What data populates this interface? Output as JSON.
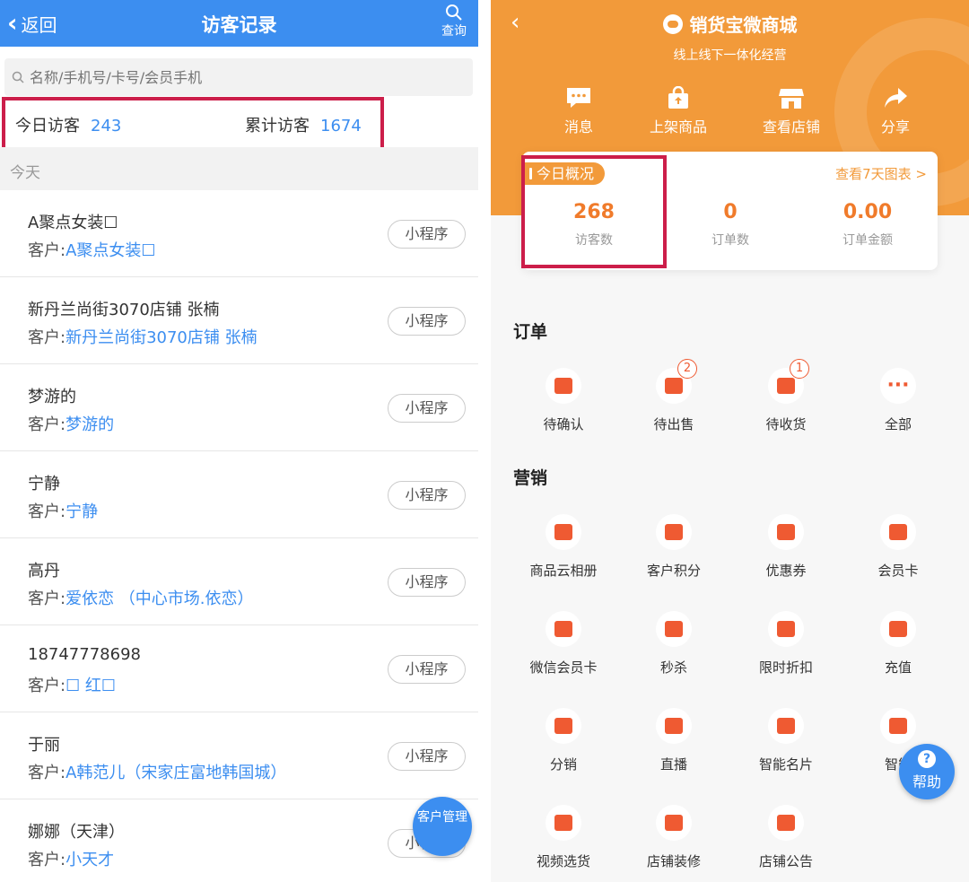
{
  "left": {
    "header": {
      "back_label": "返回",
      "title": "访客记录",
      "query_label": "查询"
    },
    "search": {
      "placeholder": "名称/手机号/卡号/会员手机"
    },
    "stats": {
      "today_label": "今日访客",
      "today_value": "243",
      "total_label": "累计访客",
      "total_value": "1674"
    },
    "section_label": "今天",
    "customer_prefix": "客户:",
    "visitors": [
      {
        "name": "A聚点女装☐",
        "customer": "A聚点女装☐",
        "tag": "小程序"
      },
      {
        "name": "新丹兰尚街3070店铺 张楠",
        "customer": "新丹兰尚街3070店铺 张楠",
        "tag": "小程序"
      },
      {
        "name": "梦游的",
        "customer": "梦游的",
        "tag": "小程序"
      },
      {
        "name": "宁静",
        "customer": "宁静",
        "tag": "小程序"
      },
      {
        "name": "高丹",
        "customer": "爱依恋 （中心市场.依恋）",
        "tag": "小程序"
      },
      {
        "name": "18747778698",
        "customer": "☐ 红☐",
        "tag": "小程序"
      },
      {
        "name": "于丽",
        "customer": "A韩范儿（宋家庄富地韩国城）",
        "tag": "小程序"
      },
      {
        "name": "娜娜（天津）",
        "customer": "小天才",
        "tag": "小程序"
      }
    ],
    "fab_label": "客户管理"
  },
  "right": {
    "header": {
      "title": "销货宝微商城",
      "subtitle": "线上线下一体化经营"
    },
    "actions": [
      {
        "label": "消息",
        "icon": "message-icon"
      },
      {
        "label": "上架商品",
        "icon": "upload-bag-icon"
      },
      {
        "label": "查看店铺",
        "icon": "store-icon"
      },
      {
        "label": "分享",
        "icon": "share-icon"
      }
    ],
    "overview": {
      "badge": "今日概况",
      "chart_link": "查看7天图表 >",
      "metrics": [
        {
          "value": "268",
          "label": "访客数"
        },
        {
          "value": "0",
          "label": "订单数"
        },
        {
          "value": "0.00",
          "label": "订单金额"
        }
      ]
    },
    "orders": {
      "title": "订单",
      "items": [
        {
          "label": "待确认",
          "icon": "pending-confirm-icon",
          "badge": ""
        },
        {
          "label": "待出售",
          "icon": "pending-sale-icon",
          "badge": "2"
        },
        {
          "label": "待收货",
          "icon": "pending-receipt-icon",
          "badge": "1"
        },
        {
          "label": "全部",
          "icon": "more-icon",
          "badge": ""
        }
      ]
    },
    "marketing": {
      "title": "营销",
      "items": [
        {
          "label": "商品云相册",
          "icon": "cloud-album-icon"
        },
        {
          "label": "客户积分",
          "icon": "points-icon"
        },
        {
          "label": "优惠券",
          "icon": "coupon-icon"
        },
        {
          "label": "会员卡",
          "icon": "member-card-icon"
        },
        {
          "label": "微信会员卡",
          "icon": "wechat-card-icon"
        },
        {
          "label": "秒杀",
          "icon": "flash-sale-icon"
        },
        {
          "label": "限时折扣",
          "icon": "limited-discount-icon"
        },
        {
          "label": "充值",
          "icon": "recharge-icon"
        },
        {
          "label": "分销",
          "icon": "distribution-icon"
        },
        {
          "label": "直播",
          "icon": "live-icon"
        },
        {
          "label": "智能名片",
          "icon": "business-card-icon"
        },
        {
          "label": "智能",
          "icon": "mail-icon"
        },
        {
          "label": "视频选货",
          "icon": "video-select-icon"
        },
        {
          "label": "店铺装修",
          "icon": "decorate-icon"
        },
        {
          "label": "店铺公告",
          "icon": "announcement-icon"
        }
      ]
    },
    "help_label": "帮助",
    "colors": {
      "accent": "#f29a3a",
      "icon": "#ef5a32",
      "blue": "#3c8ef0",
      "highlight": "#cc1e4a"
    }
  }
}
